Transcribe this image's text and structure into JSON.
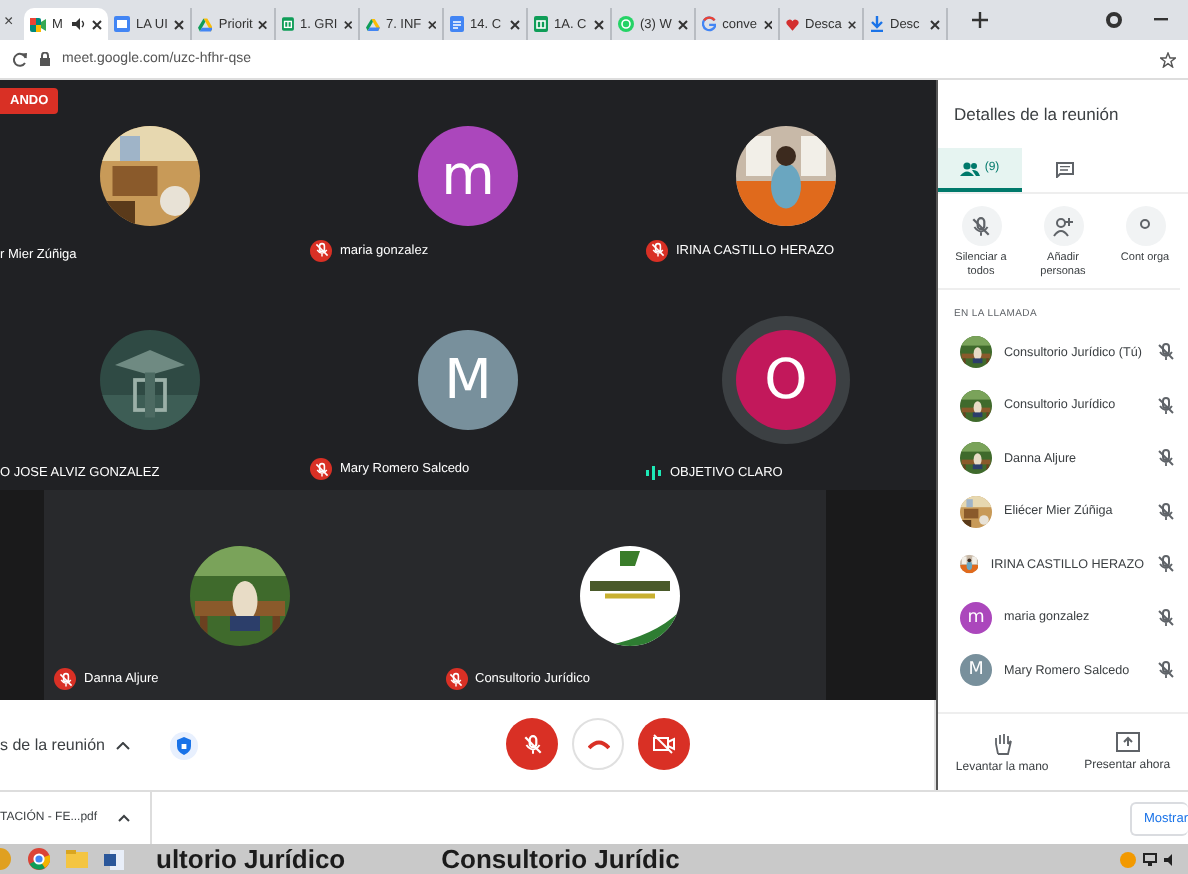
{
  "browser": {
    "partial_tab_close": "×",
    "tabs": [
      {
        "title": "M",
        "kind": "meet",
        "selected": true,
        "audio": true
      },
      {
        "title": "LA UI",
        "kind": "sites",
        "selected": false
      },
      {
        "title": "Priorit",
        "kind": "drive",
        "selected": false
      },
      {
        "title": "1. GRI",
        "kind": "sheets",
        "selected": false
      },
      {
        "title": "7. INF",
        "kind": "drive",
        "selected": false
      },
      {
        "title": "14. C",
        "kind": "docs",
        "selected": false
      },
      {
        "title": "1A. C",
        "kind": "sheets",
        "selected": false
      },
      {
        "title": "(3) W",
        "kind": "whatsapp",
        "selected": false
      },
      {
        "title": "conve",
        "kind": "google",
        "selected": false
      },
      {
        "title": "Desca",
        "kind": "heart",
        "selected": false
      },
      {
        "title": "Desc",
        "kind": "download",
        "selected": false
      }
    ],
    "address": "meet.google.com/uzc-hfhr-qse"
  },
  "recording_badge": "ANDO",
  "tiles": [
    {
      "name": "r Mier Zúñiga",
      "muted": false,
      "speaking": false
    },
    {
      "name": "maria gonzalez",
      "muted": true,
      "speaking": false,
      "avatar": {
        "kind": "letter",
        "letter": "m",
        "color": "#ab47bc"
      }
    },
    {
      "name": "IRINA CASTILLO HERAZO",
      "muted": true,
      "speaking": false
    },
    {
      "name": "O JOSE ALVIZ GONZALEZ",
      "muted": false,
      "speaking": false
    },
    {
      "name": "Mary Romero Salcedo",
      "muted": true,
      "speaking": false,
      "avatar": {
        "kind": "letter",
        "letter": "M",
        "color": "#78909c"
      }
    },
    {
      "name": "OBJETIVO CLARO",
      "muted": false,
      "speaking": true,
      "avatar": {
        "kind": "letter",
        "letter": "O",
        "color": "#c2185b"
      }
    },
    {
      "name": "Danna Aljure",
      "muted": true,
      "speaking": false
    },
    {
      "name": "Consultorio Jurídico",
      "muted": true,
      "speaking": false
    }
  ],
  "controls": {
    "details_label": "s de la reunión"
  },
  "panel": {
    "title": "Detalles de la reunión",
    "tabs": [
      {
        "kind": "people",
        "count": "(9)",
        "selected": true
      },
      {
        "kind": "chat",
        "selected": false
      }
    ],
    "actions": [
      {
        "kind": "mute-all",
        "label": "Silenciar a todos"
      },
      {
        "kind": "add-person",
        "label": "Añadir personas"
      },
      {
        "kind": "host",
        "label": "Cont orga"
      }
    ],
    "section": "EN LA LLAMADA",
    "participants": [
      {
        "name": "Consultorio Jurídico (Tú)"
      },
      {
        "name": "Consultorio Jurídico"
      },
      {
        "name": "Danna Aljure"
      },
      {
        "name": "Eliécer Mier Zúñiga"
      },
      {
        "name": "IRINA CASTILLO HERAZO"
      },
      {
        "name": "maria gonzalez",
        "avatar": {
          "kind": "letter",
          "letter": "m",
          "color": "#ab47bc"
        }
      },
      {
        "name": "Mary Romero Salcedo",
        "avatar": {
          "kind": "letter",
          "letter": "M",
          "color": "#78909c"
        }
      }
    ],
    "bottom_actions": [
      {
        "kind": "hand",
        "label": "Levantar la mano"
      },
      {
        "kind": "present",
        "label": "Presentar ahora"
      }
    ]
  },
  "download_bar": {
    "file": "TACIÓN - FE...pdf",
    "show_all": "Mostrar"
  },
  "taskbar": {
    "wallpaper_texts": [
      "ultorio Jurídico",
      "Consultorio Jurídic"
    ]
  }
}
